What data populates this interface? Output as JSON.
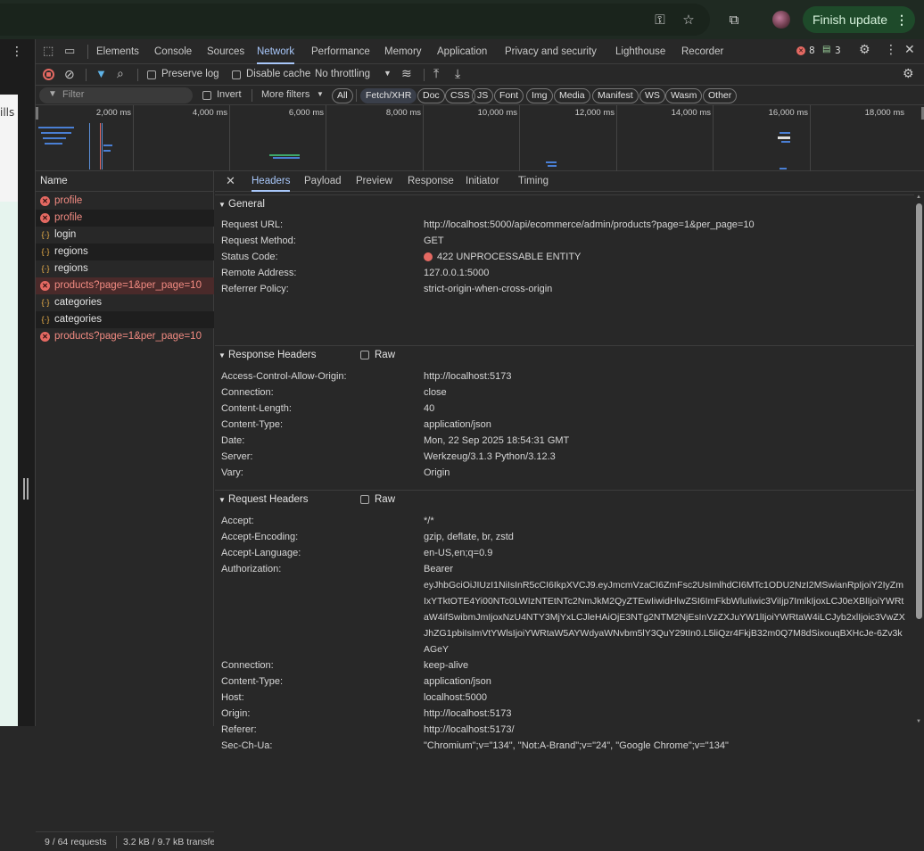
{
  "browser": {
    "finish_update": "Finish update",
    "page_text": "ills"
  },
  "devtools": {
    "tabs": [
      "Elements",
      "Console",
      "Sources",
      "Network",
      "Performance",
      "Memory",
      "Application",
      "Privacy and security",
      "Lighthouse",
      "Recorder"
    ],
    "errors_count": "8",
    "issues_count": "3",
    "toolbar": {
      "preserve_log": "Preserve log",
      "disable_cache": "Disable cache",
      "throttling": "No throttling"
    },
    "filter": {
      "placeholder": "Filter",
      "invert": "Invert",
      "more_filters": "More filters",
      "types": [
        "All",
        "Fetch/XHR",
        "Doc",
        "CSS",
        "JS",
        "Font",
        "Img",
        "Media",
        "Manifest",
        "WS",
        "Wasm",
        "Other"
      ]
    },
    "timeline": {
      "ticks": [
        "2,000 ms",
        "4,000 ms",
        "6,000 ms",
        "8,000 ms",
        "10,000 ms",
        "12,000 ms",
        "14,000 ms",
        "16,000 ms",
        "18,000 ms"
      ]
    },
    "requests": {
      "header": "Name",
      "items": [
        {
          "name": "profile",
          "status": "error"
        },
        {
          "name": "profile",
          "status": "error"
        },
        {
          "name": "login",
          "status": "ok"
        },
        {
          "name": "regions",
          "status": "ok"
        },
        {
          "name": "regions",
          "status": "ok"
        },
        {
          "name": "products?page=1&per_page=10",
          "status": "error"
        },
        {
          "name": "categories",
          "status": "ok"
        },
        {
          "name": "categories",
          "status": "ok"
        },
        {
          "name": "products?page=1&per_page=10",
          "status": "error"
        }
      ],
      "summary": "9 / 64 requests",
      "transferred": "3.2 kB / 9.7 kB transfe"
    },
    "detail": {
      "tabs": [
        "Headers",
        "Payload",
        "Preview",
        "Response",
        "Initiator",
        "Timing"
      ],
      "general": {
        "title": "General",
        "rows": [
          {
            "k": "Request URL:",
            "v": "http://localhost:5000/api/ecommerce/admin/products?page=1&per_page=10"
          },
          {
            "k": "Request Method:",
            "v": "GET"
          },
          {
            "k": "Status Code:",
            "v": "422 UNPROCESSABLE ENTITY"
          },
          {
            "k": "Remote Address:",
            "v": "127.0.0.1:5000"
          },
          {
            "k": "Referrer Policy:",
            "v": "strict-origin-when-cross-origin"
          }
        ]
      },
      "response_headers": {
        "title": "Response Headers",
        "raw": "Raw",
        "rows": [
          {
            "k": "Access-Control-Allow-Origin:",
            "v": "http://localhost:5173"
          },
          {
            "k": "Connection:",
            "v": "close"
          },
          {
            "k": "Content-Length:",
            "v": "40"
          },
          {
            "k": "Content-Type:",
            "v": "application/json"
          },
          {
            "k": "Date:",
            "v": "Mon, 22 Sep 2025 18:54:31 GMT"
          },
          {
            "k": "Server:",
            "v": "Werkzeug/3.1.3 Python/3.12.3"
          },
          {
            "k": "Vary:",
            "v": "Origin"
          }
        ]
      },
      "request_headers": {
        "title": "Request Headers",
        "raw": "Raw",
        "rows": [
          {
            "k": "Accept:",
            "v": "*/*"
          },
          {
            "k": "Accept-Encoding:",
            "v": "gzip, deflate, br, zstd"
          },
          {
            "k": "Accept-Language:",
            "v": "en-US,en;q=0.9"
          },
          {
            "k": "Authorization:",
            "v": "Bearer"
          }
        ],
        "token": "eyJhbGciOiJIUzI1NiIsInR5cCI6IkpXVCJ9.eyJmcmVzaCI6ZmFsc2UsImlhdCI6MTc1ODU2NzI2MSwianRpIjoiY2IyZmIxYTktOTE4Yi00NTc0LWIzNTEtNTc2NmJkM2QyZTEwIiwidHlwZSI6ImFkbWluIiwic3ViIjp7ImlkIjoxLCJ0eXBlIjoiYWRtaW4ifSwibmJmIjoxNzU4NTY3MjYxLCJleHAiOjE3NTg2NTM2NjEsInVzZXJuYW1lIjoiYWRtaW4iLCJyb2xlIjoic3VwZXJhZG1pbiIsImVtYWlsIjoiYWRtaW5AYWdyaWNvbm5lY3QuY29tIn0.L5liQzr4FkjB32m0Q7M8dSixouqBXHcJe-6Zv3kAGeY",
        "rows2": [
          {
            "k": "Connection:",
            "v": "keep-alive"
          },
          {
            "k": "Content-Type:",
            "v": "application/json"
          },
          {
            "k": "Host:",
            "v": "localhost:5000"
          },
          {
            "k": "Origin:",
            "v": "http://localhost:5173"
          },
          {
            "k": "Referer:",
            "v": "http://localhost:5173/"
          },
          {
            "k": "Sec-Ch-Ua:",
            "v": "\"Chromium\";v=\"134\", \"Not:A-Brand\";v=\"24\", \"Google Chrome\";v=\"134\""
          }
        ]
      }
    }
  },
  "colors": {
    "accent": "#a8c7fa",
    "error": "#e46962",
    "update": "#1e4a2a"
  }
}
